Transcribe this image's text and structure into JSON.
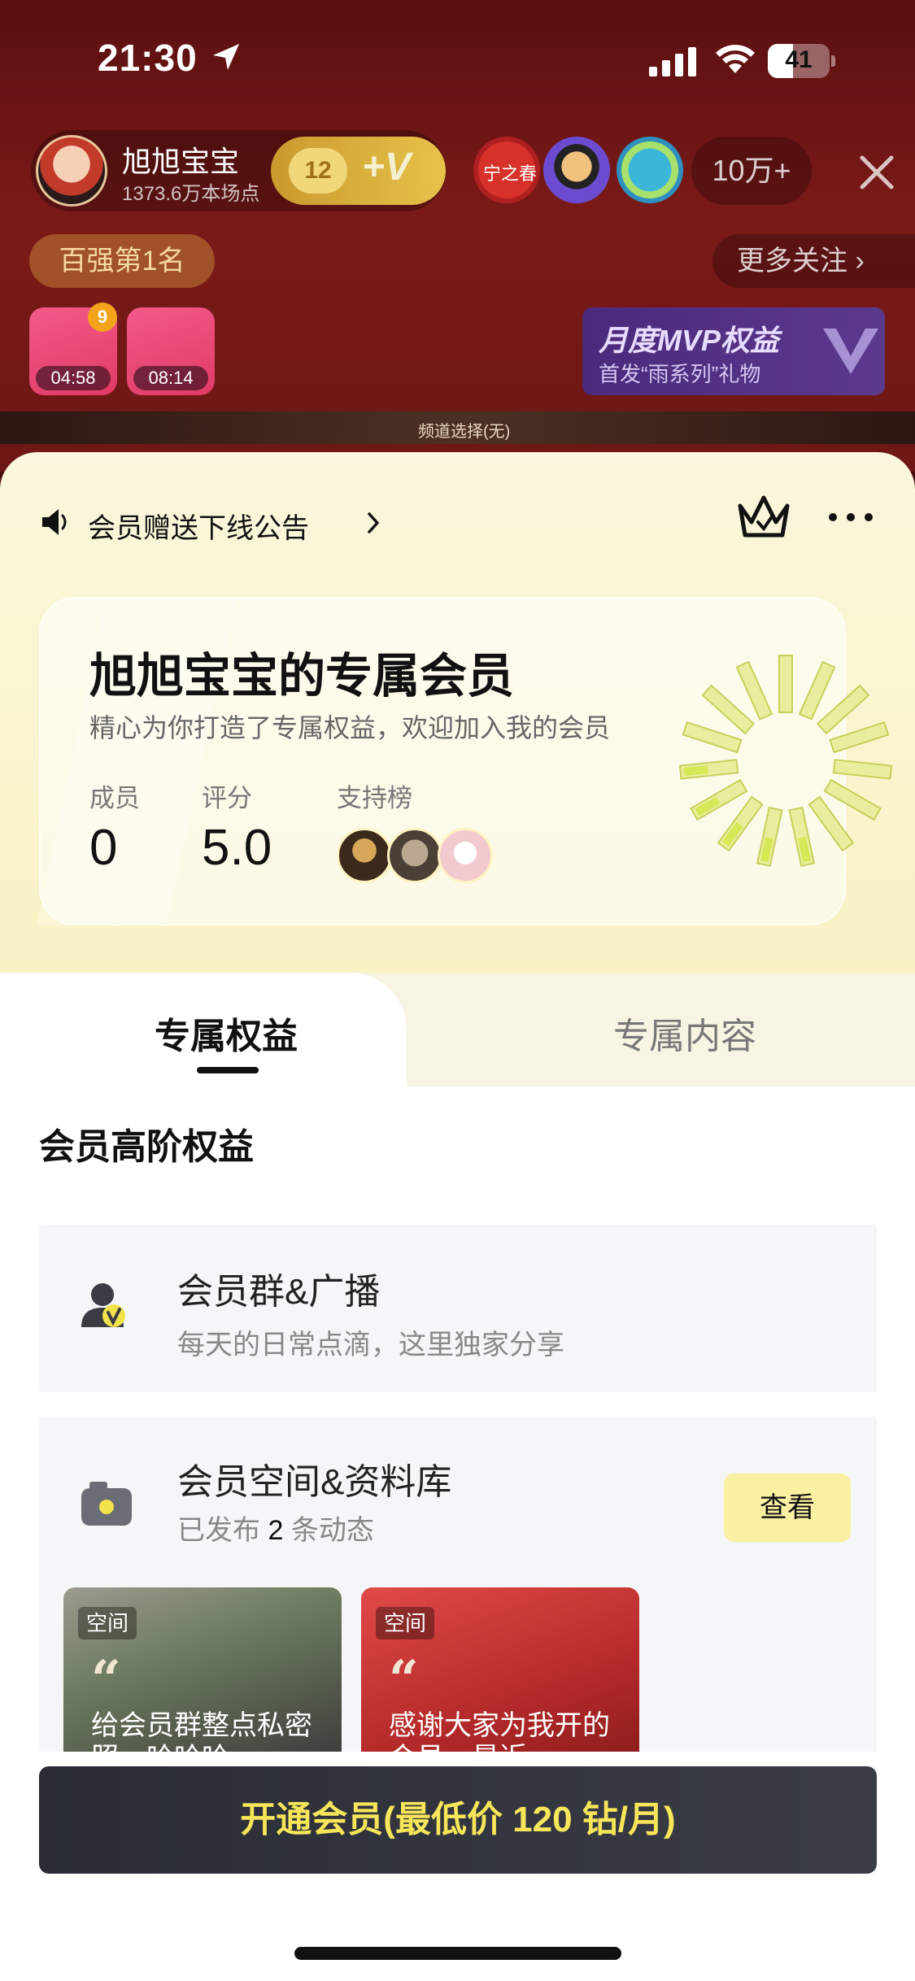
{
  "status_bar": {
    "time": "21:30",
    "battery": "41",
    "battery_level": 0.41
  },
  "live_room": {
    "host_name": "旭旭宝宝",
    "host_score": "1373.6万本场点",
    "fan_level": "12",
    "plus_v": "+V",
    "viewer_avatar_label": "宁之春",
    "viewer_count": "10万+",
    "rank": "百强第1名",
    "follow_more": "更多关注",
    "gift_boxes": [
      {
        "timer": "04:58",
        "badge": "9"
      },
      {
        "timer": "08:14",
        "badge": ""
      }
    ],
    "mvp_title": "月度MVP权益",
    "mvp_sub": "首发“雨系列”礼物",
    "channel_label": "频道选择(无)"
  },
  "sheet": {
    "notice": "会员赠送下线公告",
    "card": {
      "title": "旭旭宝宝的专属会员",
      "subtitle": "精心为你打造了专属权益，欢迎加入我的会员",
      "members_label": "成员",
      "members_value": "0",
      "score_label": "评分",
      "score_value": "5.0",
      "support_label": "支持榜"
    },
    "tabs": [
      {
        "label": "专属权益",
        "active": true
      },
      {
        "label": "专属内容",
        "active": false
      }
    ],
    "section_title": "会员高阶权益",
    "benefits": {
      "group": {
        "title": "会员群&广播",
        "desc": "每天的日常点滴，这里独家分享"
      },
      "space": {
        "title": "会员空间&资料库",
        "desc_prefix": "已发布",
        "desc_count": "2",
        "desc_suffix": "条动态",
        "button": "查看",
        "posts": [
          {
            "tag": "空间",
            "text": "给会员群整点私密照，哈哈哈"
          },
          {
            "tag": "空间",
            "text": "感谢大家为我开的会员，最近"
          }
        ]
      }
    },
    "cta": "开通会员(最低价 120 钻/月)"
  },
  "colors": {
    "accent_yellow": "#f7e65a",
    "button_yellow": "#faf0a2",
    "cta_dark": "#2a2d35"
  }
}
